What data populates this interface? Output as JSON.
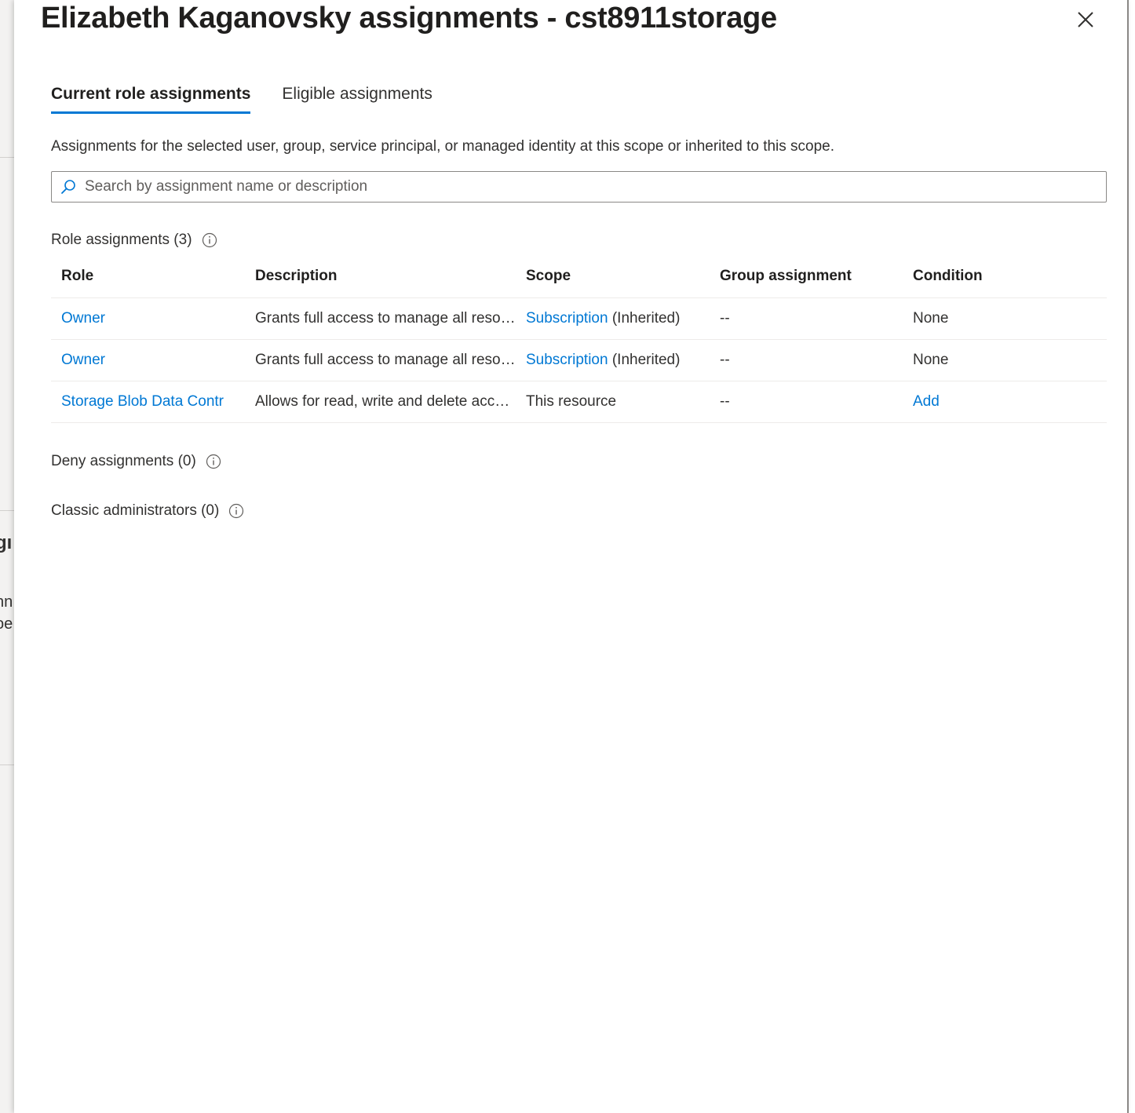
{
  "backdrop": {
    "fragments": [
      "gı",
      "nn",
      "oe"
    ]
  },
  "panel": {
    "title": "Elizabeth Kaganovsky assignments - cst8911storage",
    "close_icon": "close-icon"
  },
  "tabs": [
    {
      "label": "Current role assignments",
      "active": true
    },
    {
      "label": "Eligible assignments",
      "active": false
    }
  ],
  "intro_text": "Assignments for the selected user, group, service principal, or managed identity at this scope or inherited to this scope.",
  "search": {
    "placeholder": "Search by assignment name or description",
    "value": "",
    "icon": "search-icon"
  },
  "role_assignments": {
    "label": "Role assignments (3)",
    "info_icon": "info-icon",
    "columns": [
      "Role",
      "Description",
      "Scope",
      "Group assignment",
      "Condition"
    ],
    "rows": [
      {
        "role": "Owner",
        "description": "Grants full access to manage all resources, including the ability to assign roles in Azure RBAC.",
        "scope_link": "Subscription",
        "scope_suffix": " (Inherited)",
        "group": "--",
        "condition": "None",
        "condition_is_link": false
      },
      {
        "role": "Owner",
        "description": "Grants full access to manage all resources, including the ability to assign roles in Azure RBAC.",
        "scope_link": "Subscription",
        "scope_suffix": " (Inherited)",
        "group": "--",
        "condition": "None",
        "condition_is_link": false
      },
      {
        "role": "Storage Blob Data Contr",
        "description": "Allows for read, write and delete access to Azure Storage blob containers and data",
        "scope_link": "",
        "scope_suffix": "This resource",
        "group": "--",
        "condition": "Add",
        "condition_is_link": true
      }
    ]
  },
  "deny_assignments": {
    "label": "Deny assignments (0)",
    "info_icon": "info-icon"
  },
  "classic_administrators": {
    "label": "Classic administrators (0)",
    "info_icon": "info-icon"
  },
  "colors": {
    "accent": "#0078d4",
    "text": "#323130",
    "border": "#8a8886"
  }
}
